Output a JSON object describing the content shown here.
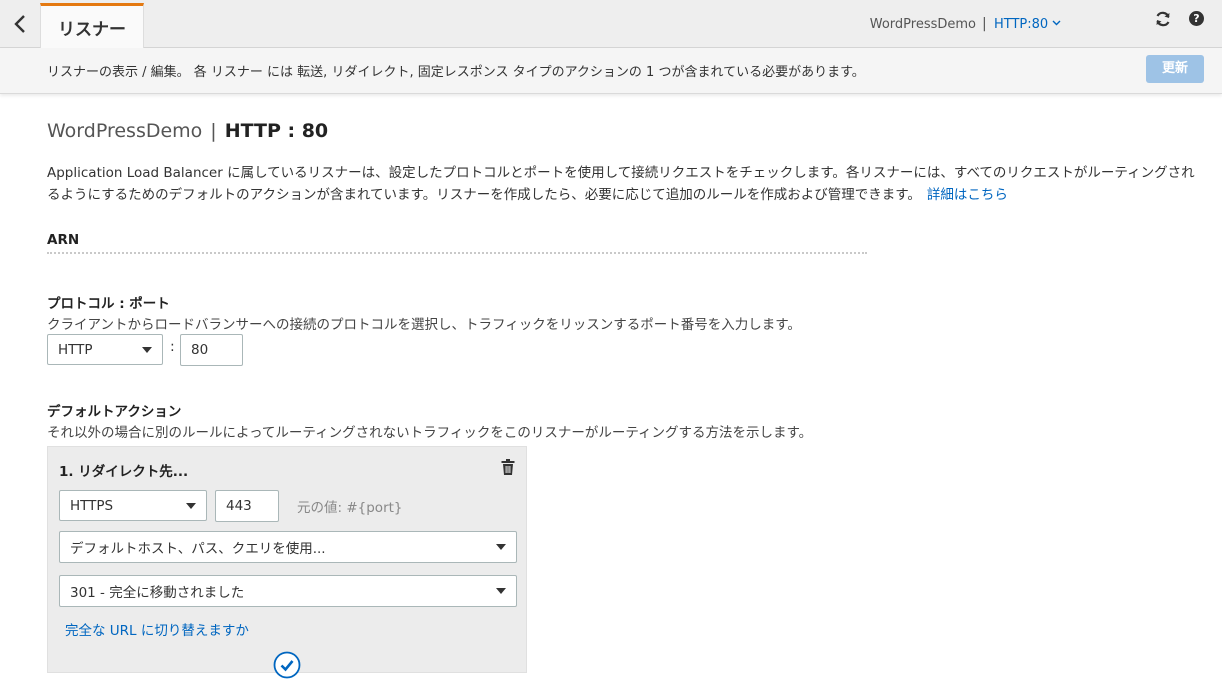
{
  "header": {
    "tab_label": "リスナー",
    "load_balancer_name": "WordPressDemo",
    "separator": "|",
    "listener_selector": "HTTP:80"
  },
  "infobar": {
    "text": "リスナーの表示 / 編集。 各 リスナー には 転送, リダイレクト, 固定レスポンス タイプのアクションの 1 つが含まれている必要があります。",
    "update_button": "更新"
  },
  "page": {
    "title_lb": "WordPressDemo",
    "title_sep": "|",
    "title_listener": "HTTP : 80",
    "description": "Application Load Balancer に属しているリスナーは、設定したプロトコルとポートを使用して接続リクエストをチェックします。各リスナーには、すべてのリクエストがルーティングされるようにするためのデフォルトのアクションが含まれています。リスナーを作成したら、必要に応じて追加のルールを作成および管理できます。",
    "learn_more": "詳細はこちら"
  },
  "arn": {
    "label": "ARN"
  },
  "protocol_port": {
    "label": "プロトコル : ポート",
    "help": "クライアントからロードバランサーへの接続のプロトコルを選択し、トラフィックをリッスンするポート番号を入力します。",
    "protocol_value": "HTTP",
    "colon": ":",
    "port_value": "80"
  },
  "default_action": {
    "label": "デフォルトアクション",
    "help": "それ以外の場合に別のルールによってルーティングされないトラフィックをこのリスナーがルーティングする方法を示します。",
    "panel_title": "1. リダイレクト先...",
    "redirect_protocol": "HTTPS",
    "redirect_port": "443",
    "original_value_note": "元の値: #{port}",
    "host_path_query_option": "デフォルトホスト、パス、クエリを使用...",
    "status_code_option": "301 - 完全に移動されました",
    "switch_to_full_url": "完全な URL に切り替えますか"
  },
  "colors": {
    "accent_tab": "#e47911",
    "link": "#0066c0",
    "primary_button_disabled": "#9ec3e6",
    "panel_bg": "#ececec"
  }
}
